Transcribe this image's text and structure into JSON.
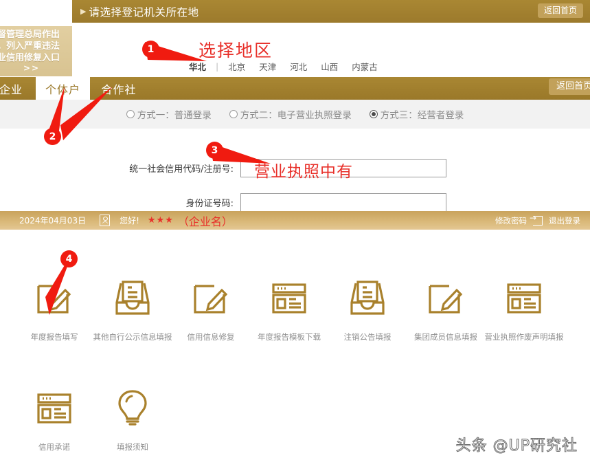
{
  "region_header": {
    "title": "请选择登记机关所在地",
    "arrow_mark": "▶",
    "return_home": "返回首页"
  },
  "region_panel": {
    "caption": "选择地区",
    "active_region": "华北",
    "separator": "|",
    "regions": [
      "北京",
      "天津",
      "河北",
      "山西",
      "内蒙古"
    ]
  },
  "side_notice": {
    "line1": "场监督管理总局作出",
    "line2": "处罚，列入严重违法",
    "line3": "单企业信用修复入口",
    "more": ">>"
  },
  "tabs": {
    "items": [
      {
        "label": "企业",
        "active": false
      },
      {
        "label": "个体户",
        "active": true
      },
      {
        "label": "合作社",
        "active": false
      }
    ],
    "return_home": "返回首页"
  },
  "login_modes": [
    {
      "label": "方式一：普通登录",
      "selected": false
    },
    {
      "label": "方式二：电子营业执照登录",
      "selected": false
    },
    {
      "label": "方式三：经营者登录",
      "selected": true
    }
  ],
  "form": {
    "fields": [
      {
        "label": "统一社会信用代码/注册号:",
        "value": "",
        "placeholder": ""
      },
      {
        "label": "身份证号码:",
        "value": "",
        "placeholder": ""
      }
    ],
    "annotation": "营业执照中有"
  },
  "user_bar": {
    "date": "2024年04月03日",
    "greeting": "您好!",
    "masked_name": "★★★",
    "annotation": "（企业名）",
    "change_password": "修改密码",
    "logout": "退出登录"
  },
  "icon_grid": {
    "row1": [
      {
        "label": "年度报告填写",
        "icon": "pencil-box-icon"
      },
      {
        "label": "其他自行公示信息填报",
        "icon": "inbox-doc-icon"
      },
      {
        "label": "信用信息修复",
        "icon": "pencil-box-icon"
      },
      {
        "label": "年度报告模板下载",
        "icon": "browser-window-icon"
      },
      {
        "label": "注销公告填报",
        "icon": "inbox-doc-icon"
      },
      {
        "label": "集团成员信息填报",
        "icon": "pencil-box-icon"
      },
      {
        "label": "营业执照作废声明填报",
        "icon": "browser-window-icon"
      }
    ],
    "row2": [
      {
        "label": "信用承诺",
        "icon": "browser-window-icon"
      },
      {
        "label": "填报须知",
        "icon": "lightbulb-icon"
      }
    ]
  },
  "annotations": {
    "badges": [
      "1",
      "2",
      "3",
      "4"
    ]
  },
  "watermark": "头条 @UP研究社",
  "colors": {
    "gold": "#9c7a2e",
    "gold_light": "#c2a15a",
    "annotation_red": "#e8302a",
    "badge_red": "#f01b10",
    "icon_gold": "#a9812c",
    "label_gray": "#8e8e8e"
  }
}
